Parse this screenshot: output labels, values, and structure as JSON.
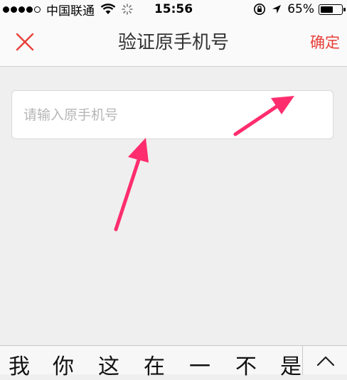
{
  "status_bar": {
    "carrier": "中国联通",
    "time": "15:56",
    "battery": "65%",
    "battery_level": 0.65,
    "signal_bars": 4,
    "signal_total": 5
  },
  "nav": {
    "title": "验证原手机号",
    "confirm_label": "确定",
    "accent_color": "#e8403a"
  },
  "form": {
    "phone_placeholder": "请输入原手机号",
    "phone_value": ""
  },
  "keyboard": {
    "candidates": [
      "我",
      "你",
      "这",
      "在",
      "一",
      "不",
      "是"
    ]
  }
}
